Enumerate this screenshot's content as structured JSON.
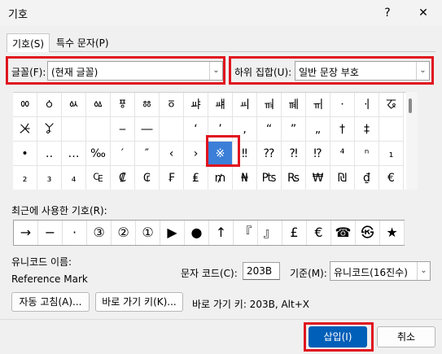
{
  "window": {
    "title": "기호",
    "help_btn": "?",
    "close_btn": "✕"
  },
  "tabs": [
    {
      "label": "기호(S)"
    },
    {
      "label": "특수 문자(P)"
    }
  ],
  "font": {
    "label": "글꼴(F):",
    "value": "(현재 글꼴)"
  },
  "subset": {
    "label": "하위 집합(U):",
    "value": "일반 문장 부호"
  },
  "symbols": [
    [
      "ㆀ",
      "ㆁ",
      "ㆂ",
      "ㆃ",
      "ㆄ",
      "ㆅ",
      "ㆆ",
      "ㆇ",
      "ㆈ",
      "ㆉ",
      "ㆊ",
      "ㆋ",
      "ㆌ",
      "ㆍ",
      "ㆎ",
      "ㆧ"
    ],
    [
      "ㆨ",
      "ㆩ",
      "",
      "",
      "‒",
      "―",
      "",
      "‘",
      "’",
      "‚",
      "“",
      "”",
      "„",
      "†",
      "‡",
      ""
    ],
    [
      "•",
      "‥",
      "…",
      "‰",
      "′",
      "″",
      "‹",
      "›",
      "※",
      "‼",
      "⁇",
      "⁈",
      "⁉",
      "⁴",
      "ⁿ",
      "₁"
    ],
    [
      "₂",
      "₃",
      "₄",
      "₠",
      "₡",
      "₢",
      "₣",
      "₤",
      "₥",
      "₦",
      "₧",
      "₨",
      "₩",
      "₪",
      "₫",
      "€"
    ]
  ],
  "recent": {
    "label": "최근에 사용한 기호(R):",
    "items": [
      "→",
      "−",
      "·",
      "③",
      "②",
      "①",
      "▶",
      "●",
      "↑",
      "『",
      "』",
      "£",
      "€",
      "☎",
      "㉿",
      "★"
    ]
  },
  "unicode_name": {
    "label": "유니코드 이름:",
    "value": "Reference Mark"
  },
  "char_code": {
    "label": "문자 코드(C):",
    "value": "203B"
  },
  "from": {
    "label": "기준(M):",
    "value": "유니코드(16진수)"
  },
  "buttons": {
    "autocorrect": "자동 고침(A)...",
    "shortcut_key": "바로 가기 키(K)...",
    "insert": "삽입(I)",
    "cancel": "취소"
  },
  "shortcut_text": "바로 가기 키: 203B, Alt+X"
}
